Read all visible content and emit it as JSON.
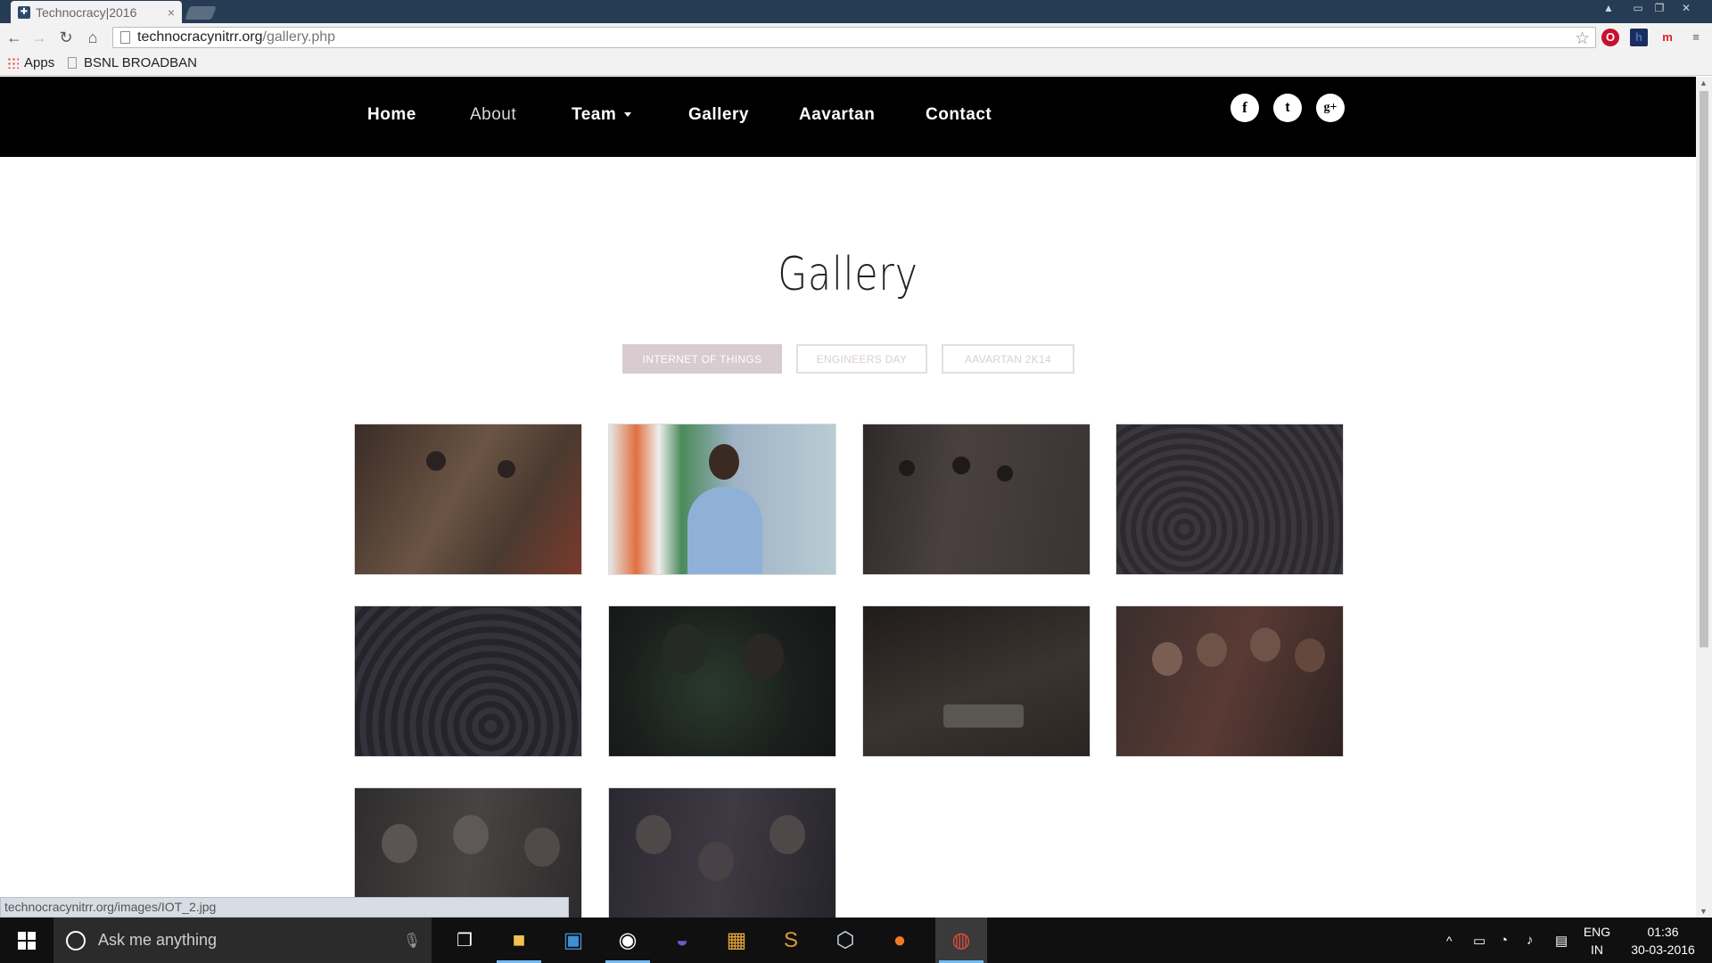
{
  "browser": {
    "tab_title": "Technocracy|2016",
    "tab_close": "×",
    "url_host": "technocracynitrr.org",
    "url_path": "/gallery.php",
    "bookmarks": {
      "apps_label": "Apps",
      "item_label": "BSNL BROADBAN"
    },
    "status_url": "technocracynitrr.org/images/IOT_2.jpg"
  },
  "site": {
    "nav": [
      {
        "label": "Home"
      },
      {
        "label": "About"
      },
      {
        "label": "Team"
      },
      {
        "label": "Gallery"
      },
      {
        "label": "Aavartan"
      },
      {
        "label": "Contact"
      }
    ],
    "social": [
      {
        "icon": "facebook-icon",
        "glyph": "f"
      },
      {
        "icon": "twitter-icon",
        "glyph": "t"
      },
      {
        "icon": "google-plus-icon",
        "glyph": "g+"
      }
    ],
    "title": "Gallery",
    "filters": [
      {
        "label": "INTERNET OF THINGS",
        "active": true
      },
      {
        "label": "ENGINEERS DAY",
        "active": false
      },
      {
        "label": "AAVARTAN 2K14",
        "active": false
      }
    ],
    "photos": [
      {
        "subject": "speakers at podium",
        "tone": "#5a4a3e"
      },
      {
        "subject": "speaker with microphone",
        "tone": "#8ea3b8"
      },
      {
        "subject": "speakers on stage",
        "tone": "#3d3838"
      },
      {
        "subject": "audience",
        "tone": "#3c3a3c"
      },
      {
        "subject": "audience",
        "tone": "#343238"
      },
      {
        "subject": "students in dark room",
        "tone": "#1f2320"
      },
      {
        "subject": "breadboard circuit",
        "tone": "#2a2624"
      },
      {
        "subject": "students group",
        "tone": "#3b2e2c"
      },
      {
        "subject": "students smiling",
        "tone": "#3a3636"
      },
      {
        "subject": "students group",
        "tone": "#2c2a2e"
      }
    ]
  },
  "taskbar": {
    "search_placeholder": "Ask me anything",
    "lang_1": "ENG",
    "lang_2": "IN",
    "time": "01:36",
    "date": "30-03-2016"
  }
}
